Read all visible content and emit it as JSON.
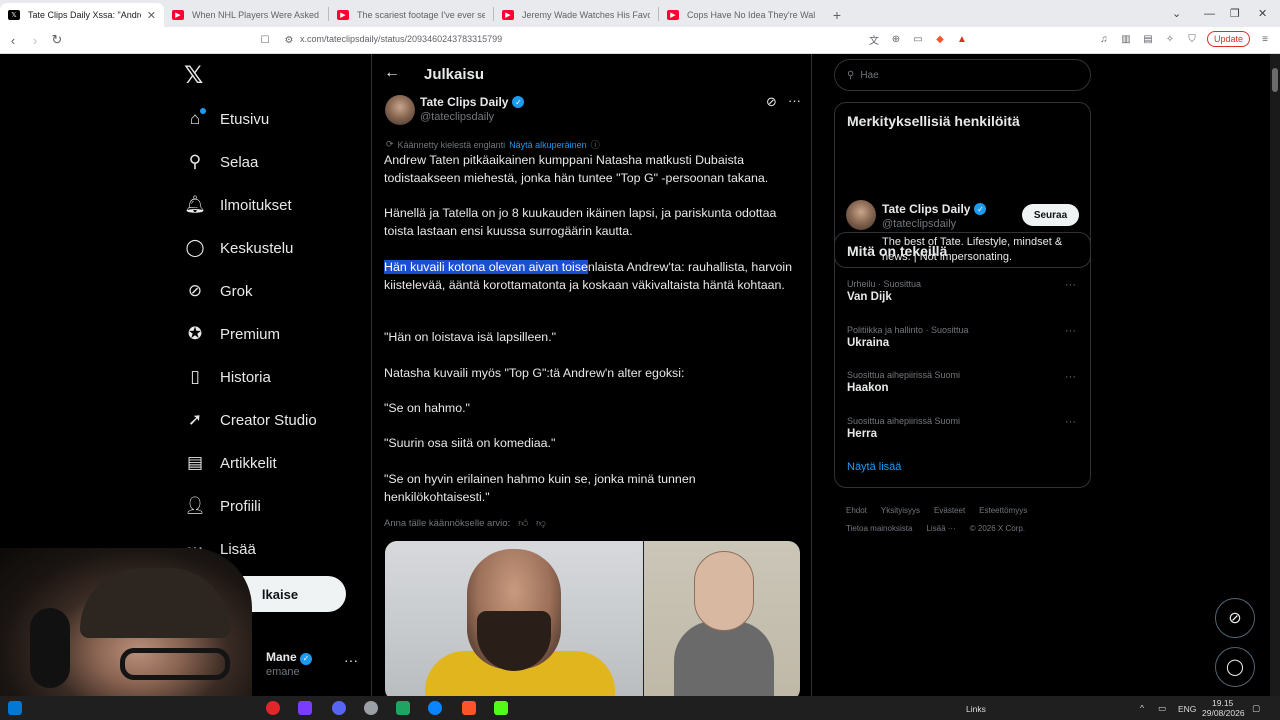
{
  "browser": {
    "tabs": [
      {
        "title": "Tate Clips Daily Xssa: \"Andrew Ta",
        "icon": "x-icon",
        "active": true
      },
      {
        "title": "When NHL Players Were Asked about",
        "icon": "youtube-icon",
        "active": false
      },
      {
        "title": "The scariest footage I've ever seen",
        "icon": "youtube-icon",
        "active": false
      },
      {
        "title": "Jeremy Wade Watches His Favourite",
        "icon": "youtube-icon",
        "active": false
      },
      {
        "title": "Cops Have No Idea They're Walking",
        "icon": "youtube-icon",
        "active": false
      }
    ],
    "url": "x.com/tateclipsdaily/status/2093460243783315799",
    "update_label": "Update"
  },
  "nav": {
    "items": [
      {
        "label": "Etusivu",
        "icon": "home-icon"
      },
      {
        "label": "Selaa",
        "icon": "search-icon"
      },
      {
        "label": "Ilmoitukset",
        "icon": "bell-icon"
      },
      {
        "label": "Keskustelu",
        "icon": "chat-bubble-icon"
      },
      {
        "label": "Grok",
        "icon": "grok-icon"
      },
      {
        "label": "Premium",
        "icon": "premium-icon"
      },
      {
        "label": "Historia",
        "icon": "bookmark-icon"
      },
      {
        "label": "Creator Studio",
        "icon": "rocket-icon"
      },
      {
        "label": "Artikkelit",
        "icon": "article-icon"
      },
      {
        "label": "Profiili",
        "icon": "profile-icon"
      },
      {
        "label": "Lisää",
        "icon": "more-icon"
      }
    ],
    "lisaa_visible": "Lisää",
    "post_visible": "lkaise",
    "account_name_visible": "Mane",
    "account_handle_visible": "emane"
  },
  "post": {
    "header_title": "Julkaisu",
    "author_name": "Tate Clips Daily",
    "author_handle": "@tateclipsdaily",
    "translated_note": "Käännetty kielestä englanti",
    "show_original": "Näytä alkuperäinen",
    "p1": "Andrew Taten pitkäaikainen kumppani Natasha matkusti Dubaista todistaakseen miehestä, jonka hän tuntee \"Top G\" -persoonan takana.",
    "p2": "Hänellä ja Tatella on jo 8 kuukauden ikäinen lapsi, ja pariskunta odottaa toista lastaan ensi kuussa surrogäärin kautta.",
    "p3_highlight": "Hän kuvaili kotona olevan aivan toise",
    "p3_rest": "nlaista Andrew'ta: rauhallista, harvoin kiistelevää, ääntä korottamatonta ja koskaan väkivaltaista häntä kohtaan.",
    "p4": "\"Hän on loistava isä lapsilleen.\"",
    "p5": "Natasha kuvaili myös \"Top G\":tä Andrew'n alter egoksi:",
    "p6": "\"Se on hahmo.\"",
    "p7": "\"Suurin osa siitä on komediaa.\"",
    "p8": "\"Se on hyvin erilainen hahmo kuin se, jonka minä tunnen henkilökohtaisesti.\"",
    "rate_translation": "Anna tälle käännökselle arvio:"
  },
  "sidebar": {
    "search_placeholder": "Hae",
    "who_to_follow_title": "Merkityksellisiä henkilöitä",
    "suggested": {
      "name": "Tate Clips Daily",
      "handle": "@tateclipsdaily",
      "bio": "The best of Tate. Lifestyle, mindset & news. | Not impersonating.",
      "follow_label": "Seuraa"
    },
    "trends_title": "Mitä on tekeillä",
    "trends": [
      {
        "meta": "Urheilu · Suosittua",
        "name": "Van Dijk"
      },
      {
        "meta": "Politiikka ja hallinto · Suosittua",
        "name": "Ukraina"
      },
      {
        "meta": "Suosittua aihepiirissä Suomi",
        "name": "Haakon"
      },
      {
        "meta": "Suosittua aihepiirissä Suomi",
        "name": "Herra"
      }
    ],
    "show_more": "Näytä lisää",
    "footer_row1": [
      "Ehdot",
      "Yksityisyys",
      "Evästeet",
      "Esteettömyys"
    ],
    "footer_row2": [
      "Tietoa mainoksista",
      "Lisää ···",
      "© 2026 X Corp."
    ]
  },
  "taskbar": {
    "links_label": "Links",
    "lang": "ENG",
    "time": "19.15",
    "date": "29/08/2026"
  },
  "colors": {
    "accent": "#1d9bf0",
    "highlight": "#1a4fd1",
    "background": "#000000",
    "border": "#2f3336"
  }
}
